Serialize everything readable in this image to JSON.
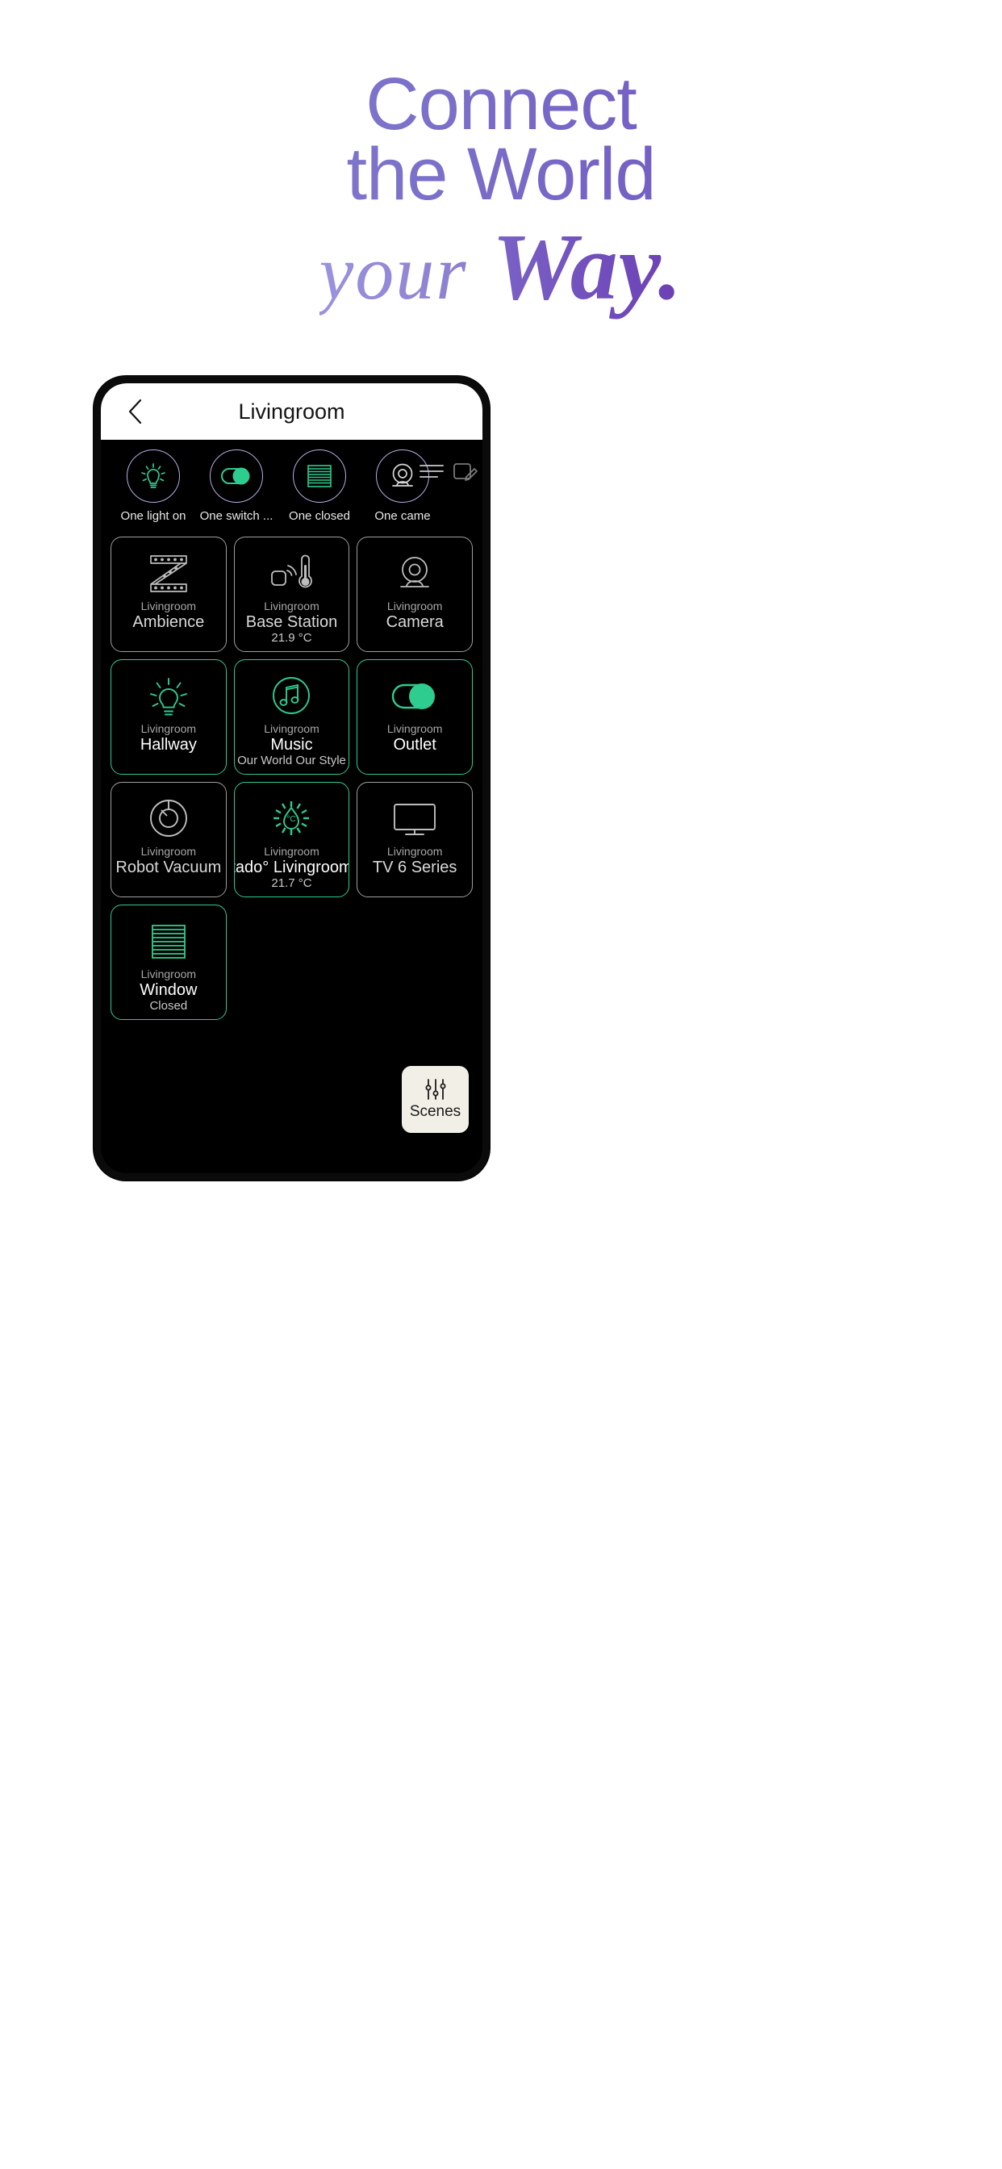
{
  "headline": {
    "line1": "Connect",
    "line2": "the World",
    "line3_your": "your",
    "line3_way": "Way.",
    "gradient_start": "#8b85d6",
    "gradient_end": "#6b3fb4"
  },
  "phone": {
    "app_bar": {
      "back_icon": "chevron-left-icon",
      "title": "Livingroom"
    },
    "status_summary": [
      {
        "icon": "lightbulb-icon",
        "label": "One light on",
        "state": "on"
      },
      {
        "icon": "toggle-on-icon",
        "label": "One switch ...",
        "state": "on"
      },
      {
        "icon": "blinds-icon",
        "label": "One closed",
        "state": "closed"
      },
      {
        "icon": "camera-icon",
        "label": "One came",
        "state": "on"
      }
    ],
    "overlay_icons": [
      {
        "icon": "menu-icon"
      },
      {
        "icon": "edit-devices-icon"
      }
    ],
    "tiles": [
      {
        "icon": "led-strip-icon",
        "room": "Livingroom",
        "name": "Ambience",
        "sub": "",
        "active": false
      },
      {
        "icon": "base-station-icon",
        "room": "Livingroom",
        "name": "Base Station",
        "sub": "21.9 °C",
        "active": false
      },
      {
        "icon": "camera-icon",
        "room": "Livingroom",
        "name": "Camera",
        "sub": "",
        "active": false
      },
      {
        "icon": "lightbulb-icon",
        "room": "Livingroom",
        "name": "Hallway",
        "sub": "",
        "active": true
      },
      {
        "icon": "music-note-icon",
        "room": "Livingroom",
        "name": "Music",
        "sub": "Our World Our Style",
        "active": true
      },
      {
        "icon": "toggle-on-icon",
        "room": "Livingroom",
        "name": "Outlet",
        "sub": "",
        "active": true
      },
      {
        "icon": "robot-vacuum-icon",
        "room": "Livingroom",
        "name": "Robot Vacuum",
        "sub": "",
        "active": false
      },
      {
        "icon": "thermostat-icon",
        "room": "Livingroom",
        "name": "tado° Livingroom",
        "sub": "21.7 °C",
        "active": true
      },
      {
        "icon": "tv-icon",
        "room": "Livingroom",
        "name": "TV 6 Series",
        "sub": "",
        "active": false
      },
      {
        "icon": "blinds-icon",
        "room": "Livingroom",
        "name": "Window",
        "sub": "Closed",
        "active": true
      }
    ],
    "scenes_button": {
      "icon": "sliders-icon",
      "label": "Scenes"
    },
    "colors": {
      "accent_green": "#2ecc8f",
      "status_ring": "#b3aee6",
      "tile_border": "#9e9e9e",
      "scenes_bg": "#f2efe6",
      "screen_bg": "#000000"
    }
  }
}
